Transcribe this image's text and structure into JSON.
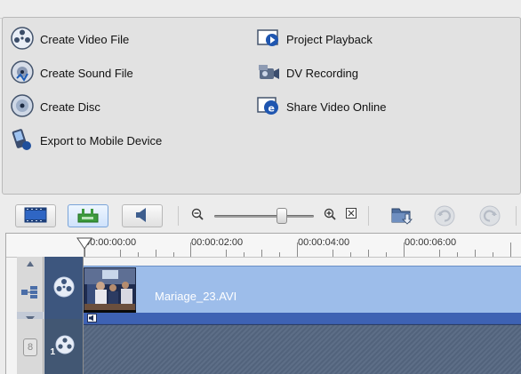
{
  "share_panel": {
    "left_actions": [
      {
        "label": "Create Video File",
        "icon": "film-reel-icon"
      },
      {
        "label": "Create Sound File",
        "icon": "sound-disc-icon"
      },
      {
        "label": "Create Disc",
        "icon": "disc-icon"
      },
      {
        "label": "Export to Mobile Device",
        "icon": "mobile-device-icon"
      }
    ],
    "right_actions": [
      {
        "label": "Project Playback",
        "icon": "playback-icon"
      },
      {
        "label": "DV Recording",
        "icon": "dv-camera-icon"
      },
      {
        "label": "Share Video Online",
        "icon": "share-online-icon"
      }
    ]
  },
  "toolbar": {
    "buttons": [
      {
        "name": "storyboard-view-button",
        "icon": "storyboard-icon",
        "active": false
      },
      {
        "name": "timeline-view-button",
        "icon": "timeline-icon",
        "active": true
      },
      {
        "name": "audio-view-button",
        "icon": "speaker-icon",
        "active": false
      }
    ],
    "zoom": {
      "level": 0.68,
      "zoom_out_icon": "zoom-out-icon",
      "zoom_in_icon": "zoom-in-icon",
      "fit_icon": "fit-to-window-icon"
    },
    "actions": [
      {
        "name": "insert-media-button",
        "icon": "folder-download-icon"
      },
      {
        "name": "undo-button",
        "icon": "undo-icon",
        "enabled": false
      },
      {
        "name": "redo-button",
        "icon": "redo-icon",
        "enabled": false
      }
    ]
  },
  "timeline": {
    "ruler_labels": [
      "00:00:00:00",
      "00:00:02:00",
      "00:00:04:00",
      "00:00:06:00"
    ],
    "video_track": {
      "icon": "video-track-icon",
      "clip_name": "Mariage_23.AVI"
    },
    "overlay_track": {
      "icon": "overlay-track-icon",
      "number": "1"
    },
    "lock_marker": "8"
  },
  "colors": {
    "track_blue": "#9dbdea",
    "track_strip": "#3e62b3",
    "lane_dark": "#5d6e87",
    "icon_blue": "#3a66b5"
  }
}
